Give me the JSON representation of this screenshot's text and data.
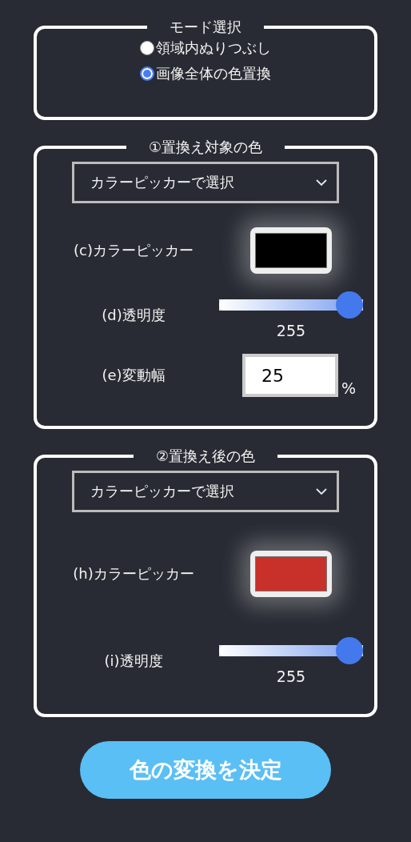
{
  "mode": {
    "title": "モード選択",
    "options": [
      {
        "label": "領域内ぬりつぶし",
        "selected": false
      },
      {
        "label": "画像全体の色置換",
        "selected": true
      }
    ]
  },
  "sections": [
    {
      "title": "①置換え対象の色",
      "select": {
        "value": "カラーピッカーで選択"
      },
      "rows": [
        {
          "kind": "color",
          "label": "(c)カラーピッカー",
          "color": "#000000"
        },
        {
          "kind": "slider",
          "label": "(d)透明度",
          "level": 1,
          "reading": "255"
        },
        {
          "kind": "number",
          "label": "(e)変動幅",
          "value": "25",
          "unit": "%"
        }
      ]
    },
    {
      "title": "②置換え後の色",
      "select": {
        "value": "カラーピッカーで選択"
      },
      "rows": [
        {
          "kind": "color",
          "label": "(h)カラーピッカー",
          "color": "#c8312a"
        },
        {
          "kind": "slider",
          "label": "(i)透明度",
          "level": 1,
          "reading": "255"
        }
      ]
    }
  ],
  "submit": {
    "label": "色の変換を決定"
  }
}
